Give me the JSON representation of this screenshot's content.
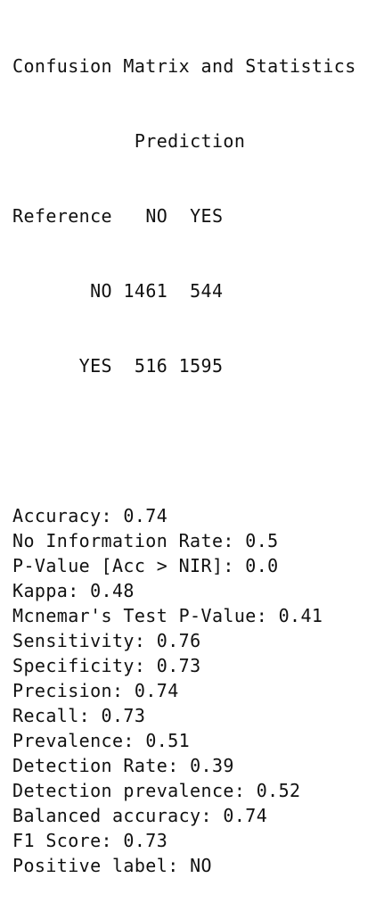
{
  "title": "Confusion Matrix and Statistics",
  "matrix": {
    "prediction_header": "Prediction",
    "reference_label": "Reference",
    "col_no": "NO",
    "col_yes": "YES",
    "rows": [
      {
        "label": "NO",
        "no": "1461",
        "yes": "544"
      },
      {
        "label": "YES",
        "no": "516",
        "yes": "1595"
      }
    ]
  },
  "stats": [
    {
      "label": "Accuracy",
      "value": "0.74"
    },
    {
      "label": "No Information Rate",
      "value": "0.5"
    },
    {
      "label": "P-Value [Acc > NIR]",
      "value": "0.0"
    },
    {
      "label": "Kappa",
      "value": "0.48"
    },
    {
      "label": "Mcnemar's Test P-Value",
      "value": "0.41"
    },
    {
      "label": "Sensitivity",
      "value": "0.76"
    },
    {
      "label": "Specificity",
      "value": "0.73"
    },
    {
      "label": "Precision",
      "value": "0.74"
    },
    {
      "label": "Recall",
      "value": "0.73"
    },
    {
      "label": "Prevalence",
      "value": "0.51"
    },
    {
      "label": "Detection Rate",
      "value": "0.39"
    },
    {
      "label": "Detection prevalence",
      "value": "0.52"
    },
    {
      "label": "Balanced accuracy",
      "value": "0.74"
    },
    {
      "label": "F1 Score",
      "value": "0.73"
    },
    {
      "label": "Positive label",
      "value": "NO"
    }
  ]
}
